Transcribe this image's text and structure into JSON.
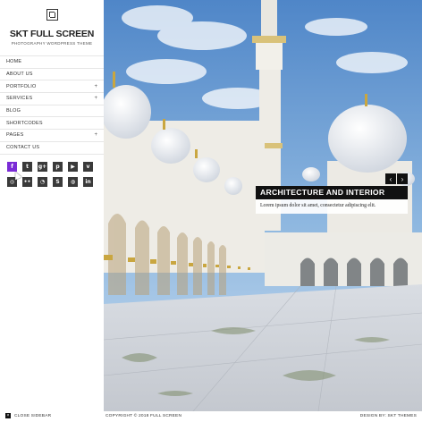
{
  "site": {
    "title": "SKT FULL SCREEN",
    "tagline": "PHOTOGRAPHY WORDPRESS THEME"
  },
  "menu": [
    {
      "label": "HOME",
      "has_sub": false
    },
    {
      "label": "ABOUT US",
      "has_sub": false
    },
    {
      "label": "PORTFOLIO",
      "has_sub": true
    },
    {
      "label": "SERVICES",
      "has_sub": true
    },
    {
      "label": "BLOG",
      "has_sub": false
    },
    {
      "label": "SHORTCODES",
      "has_sub": false
    },
    {
      "label": "PAGES",
      "has_sub": true
    },
    {
      "label": "CONTACT US",
      "has_sub": false
    }
  ],
  "submenu_indicator": "+",
  "social": [
    {
      "name": "facebook-icon",
      "glyph": "f"
    },
    {
      "name": "twitter-icon",
      "glyph": "t"
    },
    {
      "name": "google-plus-icon",
      "glyph": "g+"
    },
    {
      "name": "pinterest-icon",
      "glyph": "p"
    },
    {
      "name": "youtube-icon",
      "glyph": "▶"
    },
    {
      "name": "vimeo-icon",
      "glyph": "v"
    },
    {
      "name": "instagram-icon",
      "glyph": "◎"
    },
    {
      "name": "flickr-icon",
      "glyph": "••"
    },
    {
      "name": "rss-icon",
      "glyph": "◔"
    },
    {
      "name": "skype-icon",
      "glyph": "S"
    },
    {
      "name": "dribbble-icon",
      "glyph": "◍"
    },
    {
      "name": "linkedin-icon",
      "glyph": "in"
    }
  ],
  "slider": {
    "title": "ARCHITECTURE AND INTERIOR",
    "text": "Lorem ipsum dolor sit amet, consectetur adipiscing elit.",
    "prev": "‹",
    "next": "›"
  },
  "footer": {
    "close_label": "CLOSE SIDEBAR",
    "close_glyph": "×",
    "copyright": "COPYRIGHT © 2018 FULL SCREEN",
    "design": "DESIGN BY: SKT THEMES"
  },
  "colors": {
    "accent": "#7a2bd6",
    "icon_bg": "#3a3a3a",
    "caption_bg": "#111111"
  }
}
